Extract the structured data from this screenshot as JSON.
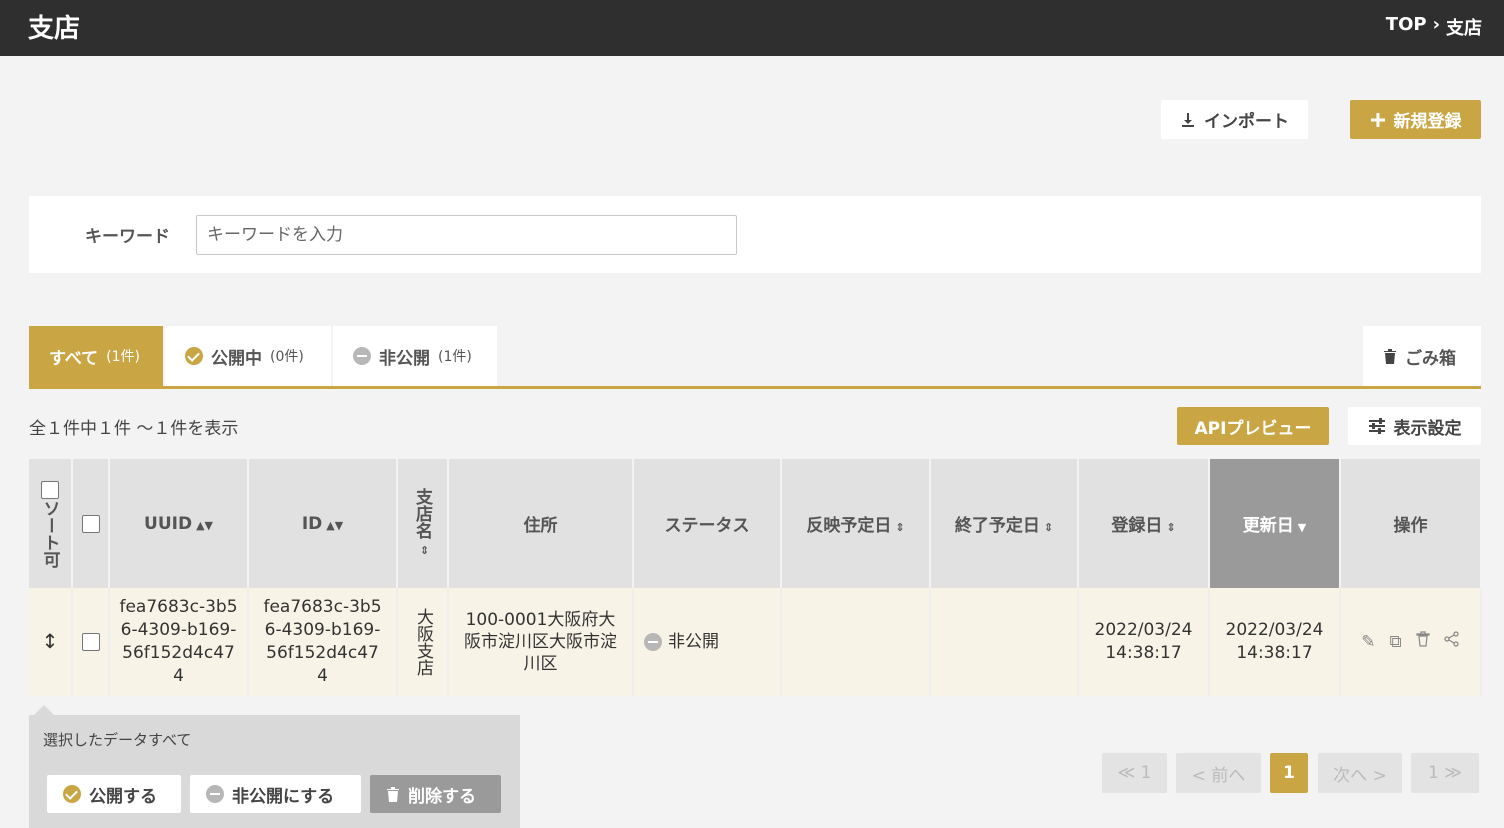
{
  "header": {
    "title": "支店",
    "breadcrumb": {
      "top": "TOP",
      "sep": "›",
      "current": "支店"
    }
  },
  "actions": {
    "import_label": "インポート",
    "new_label": "新規登録"
  },
  "search": {
    "label": "キーワード",
    "placeholder": "キーワードを入力"
  },
  "tabs": [
    {
      "label": "すべて",
      "count": "(1件)",
      "active": true
    },
    {
      "label": "公開中",
      "count": "(0件)",
      "active": false
    },
    {
      "label": "非公開",
      "count": "(1件)",
      "active": false
    }
  ],
  "trash_label": "ごみ箱",
  "result_count": "全１件中１件 〜１件を表示",
  "api_preview_label": "APIプレビュー",
  "display_settings_label": "表示設定",
  "table": {
    "headers": {
      "sortable": "ソート可",
      "uuid": "UUID",
      "id": "ID",
      "name": "支店名",
      "address": "住所",
      "status": "ステータス",
      "publish_date": "反映予定日",
      "end_date": "終了予定日",
      "created": "登録日",
      "updated": "更新日",
      "ops": "操作"
    },
    "rows": [
      {
        "uuid": "fea7683c-3b56-4309-b169-56f152d4c474",
        "id": "fea7683c-3b56-4309-b169-56f152d4c474",
        "name": "大阪支店",
        "address": "100-0001大阪府大阪市淀川区大阪市淀川区",
        "status": "非公開",
        "publish_date": "",
        "end_date": "",
        "created": "2022/03/24 14:38:17",
        "updated": "2022/03/24 14:38:17"
      }
    ]
  },
  "bulk": {
    "label": "選択したデータすべて",
    "publish_label": "公開する",
    "unpublish_label": "非公開にする",
    "delete_label": "削除する"
  },
  "pagination": {
    "first": "≪ 1",
    "prev": "< 前へ",
    "current": "1",
    "next": "次へ >",
    "last": "1 ≫"
  },
  "colors": {
    "accent": "#c9a544",
    "header_bg": "#2f2f2f"
  }
}
